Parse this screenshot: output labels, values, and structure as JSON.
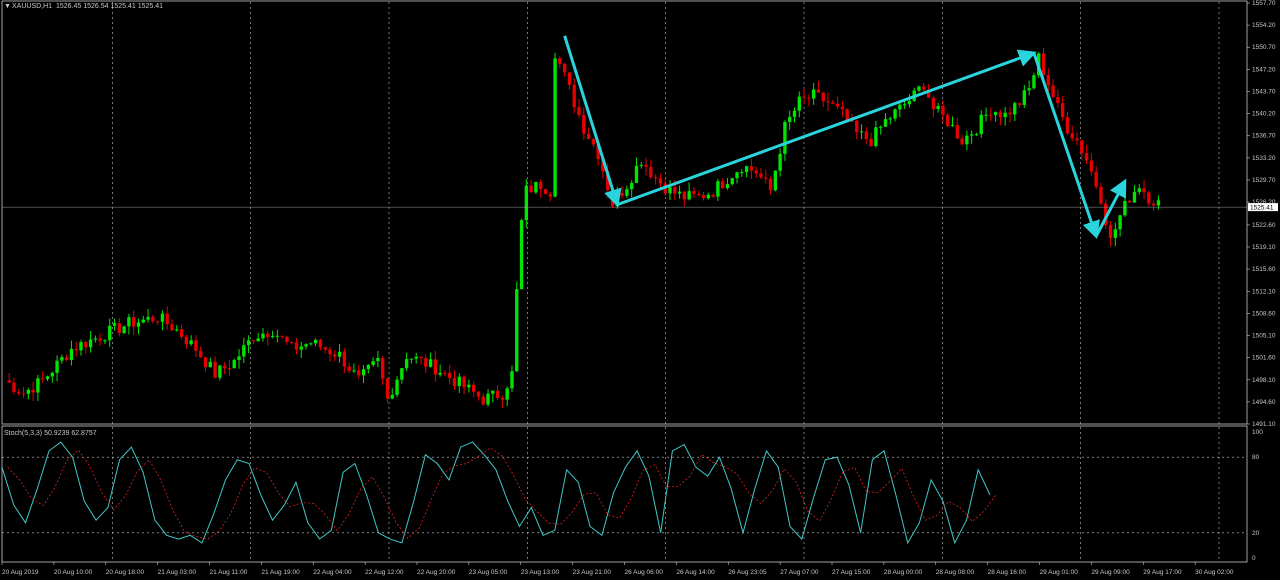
{
  "window": {
    "title": "XAUUSD,H1",
    "ohlc": "1526.45 1526.54 1525.41 1525.41"
  },
  "colors": {
    "background": "#000000",
    "grid": "#c8c8c8",
    "bull": "#00e600",
    "bear": "#e60000",
    "trendline": "#2ad4dc",
    "stoch_main": "#40c8c8",
    "stoch_signal": "#e02020",
    "price_line": "#a0a0a0"
  },
  "chart_data": [
    {
      "type": "candlestick",
      "symbol": "XAUUSD",
      "timeframe": "H1",
      "ylim": [
        1491.1,
        1557.7
      ],
      "y_ticks": [
        "1557.70",
        "1554.20",
        "1550.70",
        "1547.20",
        "1543.70",
        "1540.20",
        "1536.70",
        "1533.20",
        "1529.70",
        "1526.20",
        "1522.60",
        "1519.10",
        "1515.60",
        "1512.10",
        "1508.60",
        "1505.10",
        "1501.60",
        "1498.10",
        "1494.60",
        "1491.10"
      ],
      "x_ticks": [
        "20 Aug 2019",
        "20 Aug 10:00",
        "20 Aug 18:00",
        "21 Aug 03:00",
        "21 Aug 11:00",
        "21 Aug 19:00",
        "22 Aug 04:00",
        "22 Aug 12:00",
        "22 Aug 20:00",
        "23 Aug 05:00",
        "23 Aug 13:00",
        "23 Aug 21:00",
        "26 Aug 06:00",
        "26 Aug 14:00",
        "26 Aug 23:05",
        "27 Aug 07:00",
        "27 Aug 15:00",
        "28 Aug 00:00",
        "28 Aug 08:00",
        "28 Aug 16:00",
        "29 Aug 01:00",
        "29 Aug 09:00",
        "29 Aug 17:00",
        "30 Aug 02:00"
      ],
      "current_price": "1525.41",
      "price_path": [
        [
          0,
          1498
        ],
        [
          4,
          1496
        ],
        [
          8,
          1498
        ],
        [
          14,
          1503
        ],
        [
          20,
          1505
        ],
        [
          26,
          1507
        ],
        [
          32,
          1508
        ],
        [
          36,
          1506
        ],
        [
          40,
          1503
        ],
        [
          44,
          1499
        ],
        [
          48,
          1501
        ],
        [
          52,
          1505
        ],
        [
          56,
          1506
        ],
        [
          60,
          1503
        ],
        [
          64,
          1504
        ],
        [
          70,
          1502
        ],
        [
          74,
          1498
        ],
        [
          78,
          1501
        ],
        [
          80,
          1495
        ],
        [
          84,
          1502
        ],
        [
          90,
          1500
        ],
        [
          96,
          1497
        ],
        [
          100,
          1495
        ],
        [
          104,
          1496
        ],
        [
          106,
          1499
        ],
        [
          107,
          1512
        ],
        [
          108,
          1523
        ],
        [
          109,
          1528
        ],
        [
          112,
          1529
        ],
        [
          114,
          1528
        ],
        [
          115,
          1550
        ],
        [
          118,
          1544
        ],
        [
          121,
          1538
        ],
        [
          124,
          1534
        ],
        [
          127,
          1526
        ],
        [
          130,
          1529
        ],
        [
          133,
          1533
        ],
        [
          136,
          1530
        ],
        [
          139,
          1528
        ],
        [
          142,
          1527
        ],
        [
          145,
          1527
        ],
        [
          148,
          1528
        ],
        [
          151,
          1530
        ],
        [
          154,
          1532
        ],
        [
          157,
          1531
        ],
        [
          160,
          1528
        ],
        [
          163,
          1538
        ],
        [
          166,
          1542
        ],
        [
          169,
          1543
        ],
        [
          172,
          1542
        ],
        [
          175,
          1540
        ],
        [
          178,
          1537
        ],
        [
          181,
          1536
        ],
        [
          184,
          1539
        ],
        [
          187,
          1541
        ],
        [
          190,
          1543
        ],
        [
          192,
          1545
        ],
        [
          194,
          1541
        ],
        [
          197,
          1539
        ],
        [
          200,
          1536
        ],
        [
          203,
          1538
        ],
        [
          206,
          1541
        ],
        [
          209,
          1540
        ],
        [
          212,
          1542
        ],
        [
          214,
          1544
        ],
        [
          216,
          1549
        ],
        [
          218,
          1545
        ],
        [
          220,
          1541
        ],
        [
          222,
          1538
        ],
        [
          224,
          1536
        ],
        [
          226,
          1533
        ],
        [
          229,
          1527
        ],
        [
          231,
          1520
        ],
        [
          233,
          1524
        ],
        [
          235,
          1527
        ],
        [
          237,
          1529
        ],
        [
          239,
          1527
        ],
        [
          241,
          1526
        ]
      ],
      "trendlines": [
        {
          "from": [
            117,
            1552.5
          ],
          "to": [
            128,
            1525.8
          ],
          "arrow": true
        },
        {
          "from": [
            128,
            1525.8
          ],
          "to": [
            215,
            1549.8
          ],
          "arrow": true
        },
        {
          "from": [
            215,
            1549.8
          ],
          "to": [
            228,
            1520.8
          ],
          "arrow": true
        },
        {
          "from": [
            228,
            1520.8
          ],
          "to": [
            234,
            1529.5
          ],
          "arrow": true
        }
      ]
    },
    {
      "type": "line",
      "title": "Stoch(5,3,3) 50.9239 62.8757",
      "ylim": [
        0,
        100
      ],
      "y_ticks": [
        "100",
        "80",
        "20",
        "0"
      ],
      "levels": [
        80,
        20
      ],
      "series": [
        {
          "name": "main",
          "values": [
            72,
            42,
            28,
            55,
            85,
            92,
            80,
            45,
            30,
            40,
            78,
            88,
            68,
            30,
            18,
            15,
            18,
            12,
            35,
            62,
            78,
            75,
            50,
            30,
            42,
            60,
            28,
            15,
            22,
            68,
            75,
            50,
            20,
            15,
            12,
            45,
            82,
            75,
            62,
            88,
            92,
            82,
            70,
            45,
            25,
            40,
            18,
            22,
            70,
            60,
            25,
            18,
            52,
            72,
            85,
            65,
            20,
            85,
            90,
            72,
            65,
            80,
            55,
            20,
            55,
            85,
            72,
            25,
            15,
            48,
            78,
            80,
            58,
            20,
            78,
            85,
            50,
            12,
            28,
            62,
            45,
            12,
            30,
            70,
            50
          ],
          "x": [
            0,
            3,
            6,
            9,
            12,
            15,
            18,
            21,
            24,
            27,
            30,
            33,
            36,
            39,
            42,
            45,
            48,
            51,
            54,
            57,
            60,
            63,
            66,
            69,
            72,
            75,
            78,
            81,
            84,
            87,
            90,
            93,
            96,
            99,
            102,
            105,
            108,
            111,
            114,
            117,
            120,
            123,
            126,
            129,
            132,
            135,
            138,
            141,
            144,
            147,
            150,
            153,
            156,
            159,
            162,
            165,
            168,
            171,
            174,
            177,
            180,
            183,
            186,
            189,
            192,
            195,
            198,
            201,
            204,
            207,
            210,
            213,
            216,
            219,
            222,
            225,
            228,
            231,
            234,
            237,
            240,
            243,
            246,
            249,
            252
          ]
        },
        {
          "name": "signal",
          "values": []
        }
      ]
    }
  ]
}
